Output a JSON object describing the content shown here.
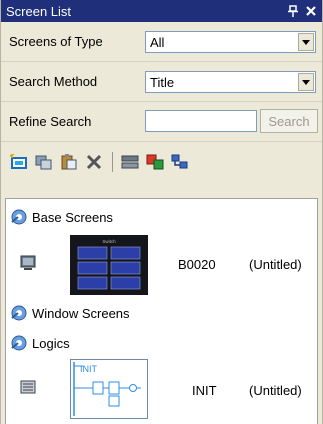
{
  "window": {
    "title": "Screen List",
    "pin_glyph": "↑",
    "close_glyph": "✕"
  },
  "filters": {
    "screens_of_type": {
      "label": "Screens of Type",
      "value": "All"
    },
    "search_method": {
      "label": "Search Method",
      "value": "Title"
    },
    "refine_search": {
      "label": "Refine Search",
      "value": "",
      "button_label": "Search"
    }
  },
  "toolbar": {
    "tools": [
      "new-screen-icon",
      "duplicate-icon",
      "paste-icon",
      "delete-icon",
      "properties-icon",
      "import-icon",
      "export-icon"
    ]
  },
  "tree": {
    "base_screens": {
      "label": "Base Screens"
    },
    "window_screens": {
      "label": "Window Screens"
    },
    "logics": {
      "label": "Logics"
    },
    "entries": [
      {
        "name": "B0020",
        "title": "(Untitled)",
        "thumb_text": "Switch"
      },
      {
        "name": "INIT",
        "title": "(Untitled)",
        "thumb_text": "INIT"
      }
    ]
  },
  "colors": {
    "titlebar": "#1f2f7a",
    "panel": "#ece9d8",
    "thumb_dark": "#15151c",
    "thumb_tile": "#2c3fa8",
    "logic_blue": "#2f8fe0"
  }
}
